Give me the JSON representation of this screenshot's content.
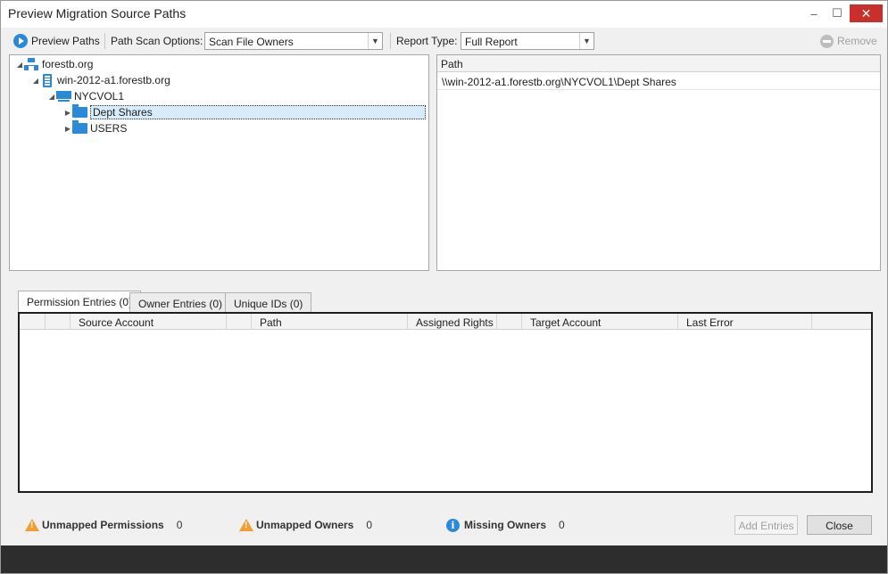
{
  "window": {
    "title": "Preview Migration Source Paths",
    "minimize_glyph": "–",
    "maximize_glyph": "☐",
    "close_glyph": "✕"
  },
  "toolbar": {
    "preview_label": "Preview Paths",
    "scan_options_label": "Path Scan Options:",
    "scan_options_value": "Scan File Owners",
    "report_type_label": "Report Type:",
    "report_type_value": "Full Report",
    "remove_label": "Remove",
    "dropdown_glyph": "▼"
  },
  "tree": {
    "expanded_glyph": "◢",
    "collapsed_glyph": "▶",
    "items": [
      {
        "label": "forestb.org",
        "icon": "network-icon"
      },
      {
        "label": "win-2012-a1.forestb.org",
        "icon": "server-icon"
      },
      {
        "label": "NYCVOL1",
        "icon": "share-icon"
      },
      {
        "label": "Dept Shares",
        "icon": "folder-icon",
        "selected": true
      },
      {
        "label": "USERS",
        "icon": "folder-icon"
      }
    ]
  },
  "path_panel": {
    "header": "Path",
    "rows": [
      "\\\\win-2012-a1.forestb.org\\NYCVOL1\\Dept Shares"
    ]
  },
  "tabs": [
    {
      "label": "Permission Entries (0)",
      "active": true
    },
    {
      "label": "Owner Entries (0)",
      "active": false
    },
    {
      "label": "Unique IDs (0)",
      "active": false
    }
  ],
  "entries_grid": {
    "columns": [
      "",
      "",
      "Source Account",
      "",
      "Path",
      "Assigned Rights",
      "",
      "Target Account",
      "Last Error",
      ""
    ]
  },
  "status": {
    "unmapped_permissions_label": "Unmapped Permissions",
    "unmapped_permissions_count": "0",
    "unmapped_owners_label": "Unmapped Owners",
    "unmapped_owners_count": "0",
    "missing_owners_label": "Missing Owners",
    "missing_owners_count": "0",
    "info_glyph": "i"
  },
  "buttons": {
    "add_entries": "Add Entries",
    "close": "Close"
  },
  "colors": {
    "accent": "#2a8ad8",
    "warning": "#f0a030",
    "selection": "#d7ebfa",
    "close_button": "#c9302c",
    "footer": "#2d2d2d"
  }
}
